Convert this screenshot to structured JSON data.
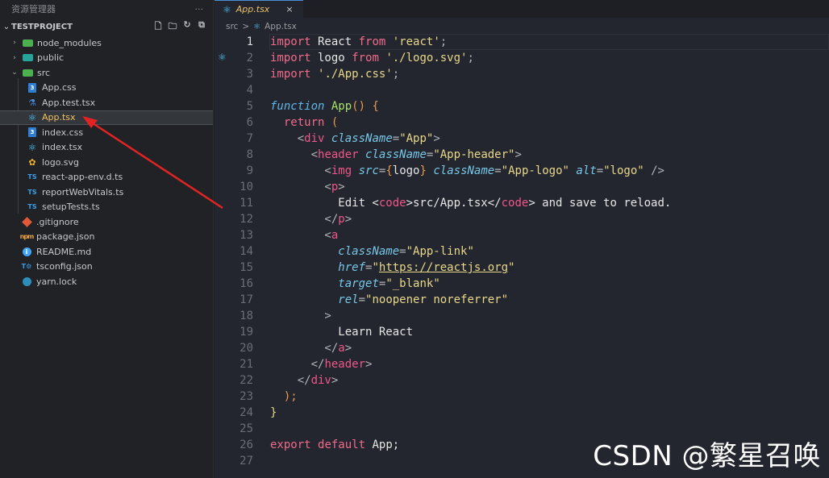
{
  "sidebar": {
    "header_title": "资源管理器",
    "header_more": "···",
    "project_name": "TESTPROJECT",
    "items": [
      {
        "label": "node_modules",
        "chev": "›",
        "icon": "folder-icon"
      },
      {
        "label": "public",
        "chev": "›",
        "icon": "folder-icon"
      },
      {
        "label": "src",
        "chev": "⌄",
        "icon": "folder-open-icon"
      },
      {
        "label": "App.css",
        "icon": "css-icon"
      },
      {
        "label": "App.test.tsx",
        "icon": "test-icon"
      },
      {
        "label": "App.tsx",
        "icon": "react-icon"
      },
      {
        "label": "index.css",
        "icon": "css-icon"
      },
      {
        "label": "index.tsx",
        "icon": "react-icon"
      },
      {
        "label": "logo.svg",
        "icon": "svg-icon"
      },
      {
        "label": "react-app-env.d.ts",
        "icon": "typescript-icon"
      },
      {
        "label": "reportWebVitals.ts",
        "icon": "typescript-icon"
      },
      {
        "label": "setupTests.ts",
        "icon": "typescript-icon"
      },
      {
        "label": ".gitignore",
        "icon": "git-icon"
      },
      {
        "label": "package.json",
        "icon": "json-icon"
      },
      {
        "label": "README.md",
        "icon": "info-icon"
      },
      {
        "label": "tsconfig.json",
        "icon": "typescript-config-icon"
      },
      {
        "label": "yarn.lock",
        "icon": "yarn-icon"
      }
    ]
  },
  "editor": {
    "tab_label": "App.tsx",
    "tab_close": "×",
    "breadcrumb": {
      "folder": "src",
      "sep": ">",
      "file": "App.tsx"
    },
    "lines": [
      "1",
      "2",
      "3",
      "4",
      "5",
      "6",
      "7",
      "8",
      "9",
      "10",
      "11",
      "12",
      "13",
      "14",
      "15",
      "16",
      "17",
      "18",
      "19",
      "20",
      "21",
      "22",
      "23",
      "24",
      "25",
      "26",
      "27"
    ],
    "code": {
      "l1": [
        "import",
        " React ",
        "from",
        " ",
        "'react'",
        ";"
      ],
      "l2": [
        "import",
        " logo ",
        "from",
        " ",
        "'./logo.svg'",
        ";"
      ],
      "l3": [
        "import",
        " ",
        "'./App.css'",
        ";"
      ],
      "l5": [
        "function",
        " ",
        "App",
        "() {"
      ],
      "l6": [
        "  ",
        "return",
        " ("
      ],
      "l7": [
        "    <",
        "div",
        " ",
        "className",
        "=",
        "\"App\"",
        ">"
      ],
      "l8": [
        "      <",
        "header",
        " ",
        "className",
        "=",
        "\"App-header\"",
        ">"
      ],
      "l9": [
        "        <",
        "img",
        " ",
        "src",
        "=",
        "{",
        "logo",
        "}",
        " ",
        "className",
        "=",
        "\"App-logo\"",
        " ",
        "alt",
        "=",
        "\"logo\"",
        " />"
      ],
      "l10": [
        "        <",
        "p",
        ">"
      ],
      "l11": [
        "          Edit <",
        "code",
        ">src/App.tsx</",
        "code",
        "> and save to reload."
      ],
      "l12": [
        "        </",
        "p",
        ">"
      ],
      "l13": [
        "        <",
        "a"
      ],
      "l14": [
        "          ",
        "className",
        "=",
        "\"App-link\""
      ],
      "l15": [
        "          ",
        "href",
        "=",
        "\"",
        "https://reactjs.org",
        "\""
      ],
      "l16": [
        "          ",
        "target",
        "=",
        "\"_blank\""
      ],
      "l17": [
        "          ",
        "rel",
        "=",
        "\"noopener noreferrer\""
      ],
      "l18": [
        "        >"
      ],
      "l19": [
        "          Learn React"
      ],
      "l20": [
        "        </",
        "a",
        ">"
      ],
      "l21": [
        "      </",
        "header",
        ">"
      ],
      "l22": [
        "    </",
        "div",
        ">"
      ],
      "l23": [
        "  );"
      ],
      "l24": [
        "}"
      ],
      "l26": [
        "export",
        " ",
        "default",
        " App;"
      ]
    }
  },
  "watermark": {
    "text": "CSDN @繁星召唤"
  }
}
